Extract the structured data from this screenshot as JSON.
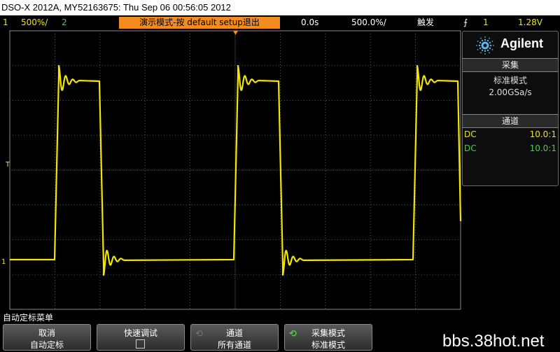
{
  "header": {
    "title": "DSO-X 2012A, MY52163675: Thu Sep 06 00:56:05 2012"
  },
  "status": {
    "ch1_num": "1",
    "ch1_scale": "500%/",
    "ch2_num": "2",
    "banner": "演示模式-按 default setup退出",
    "time_delay": "0.0s",
    "time_scale": "500.0%/",
    "trigger_mode": "触发",
    "trigger_source": "1",
    "trigger_level": "1.28V"
  },
  "panel": {
    "brand": "Agilent",
    "acq_title": "采集",
    "acq_mode": "标准模式",
    "sample_rate": "2.00GSa/s",
    "ch_title": "通道",
    "channels": [
      {
        "coupling": "DC",
        "probe": "10.0:1",
        "color": "#f2e600"
      },
      {
        "coupling": "DC",
        "probe": "10.0:1",
        "color": "#3fd43f"
      }
    ]
  },
  "scope": {
    "trigger_marker": "T",
    "ground_marker": "1",
    "trace_color": "#f2e600"
  },
  "menu": {
    "label": "自动定标菜单"
  },
  "softkeys": [
    {
      "top": "取消",
      "bottom": "自动定标"
    },
    {
      "top": "快速调试",
      "bottom": ""
    },
    {
      "top": "通道",
      "bottom": "所有通道"
    },
    {
      "top": "采集模式",
      "bottom": "标准模式"
    }
  ],
  "watermark": "bbs.38hot.net"
}
